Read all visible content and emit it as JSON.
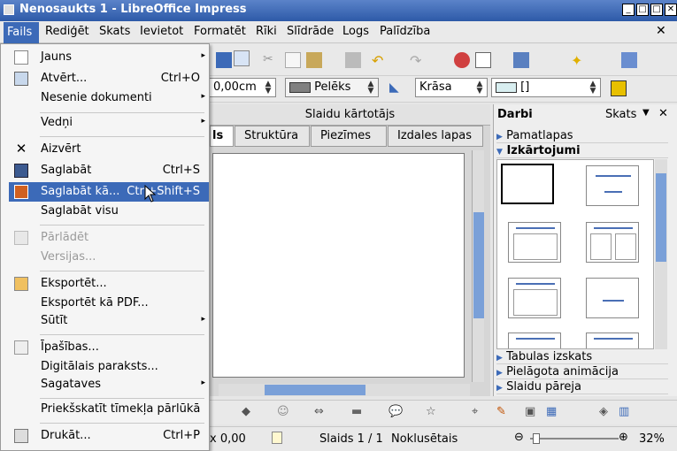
{
  "window": {
    "title": "Nenosaukts 1 - LibreOffice Impress"
  },
  "menubar": {
    "items": [
      "Fails",
      "Rediģēt",
      "Skats",
      "Ievietot",
      "Formatēt",
      "Rīki",
      "Slīdrāde",
      "Logs",
      "Palīdzība"
    ]
  },
  "toolbar": {
    "width_value": "0,00cm",
    "line_color": "Pelēks",
    "area_style": "Krāsa",
    "area_value": "[]"
  },
  "slide_sorter": {
    "title": "Slaidu kārtotājs",
    "tabs": [
      "ls",
      "Struktūra",
      "Piezīmes",
      "Izdales lapas"
    ]
  },
  "task_pane": {
    "title": "Darbi",
    "view_label": "Skats",
    "sections": [
      "Pamatlapas",
      "Izkārtojumi",
      "Tabulas izskats",
      "Pielāgota animācija",
      "Slaidu pāreja"
    ]
  },
  "statusbar": {
    "position": "x 0,00",
    "slide": "Slaids 1 / 1",
    "layout": "Noklusētais",
    "zoom": "32%"
  },
  "file_menu": {
    "items": [
      {
        "label": "Jauns",
        "submenu": true
      },
      {
        "label": "Atvērt...",
        "accel": "Ctrl+O"
      },
      {
        "label": "Nesenie dokumenti",
        "submenu": true
      },
      {
        "label": "Vedņi",
        "submenu": true
      },
      {
        "label": "Aizvērt"
      },
      {
        "label": "Saglabāt",
        "accel": "Ctrl+S"
      },
      {
        "label": "Saglabāt kā...",
        "accel": "Ctrl+Shift+S"
      },
      {
        "label": "Saglabāt visu"
      },
      {
        "label": "Pārlādēt"
      },
      {
        "label": "Versijas..."
      },
      {
        "label": "Eksportēt..."
      },
      {
        "label": "Eksportēt kā PDF..."
      },
      {
        "label": "Sūtīt",
        "submenu": true
      },
      {
        "label": "Īpašības..."
      },
      {
        "label": "Digitālais paraksts..."
      },
      {
        "label": "Sagataves",
        "submenu": true
      },
      {
        "label": "Priekšskatīt tīmekļa pārlūkā"
      },
      {
        "label": "Drukāt...",
        "accel": "Ctrl+P"
      }
    ]
  },
  "colors": {
    "accent": "#3c6ab8",
    "title_bar": "#2d5aa8"
  }
}
